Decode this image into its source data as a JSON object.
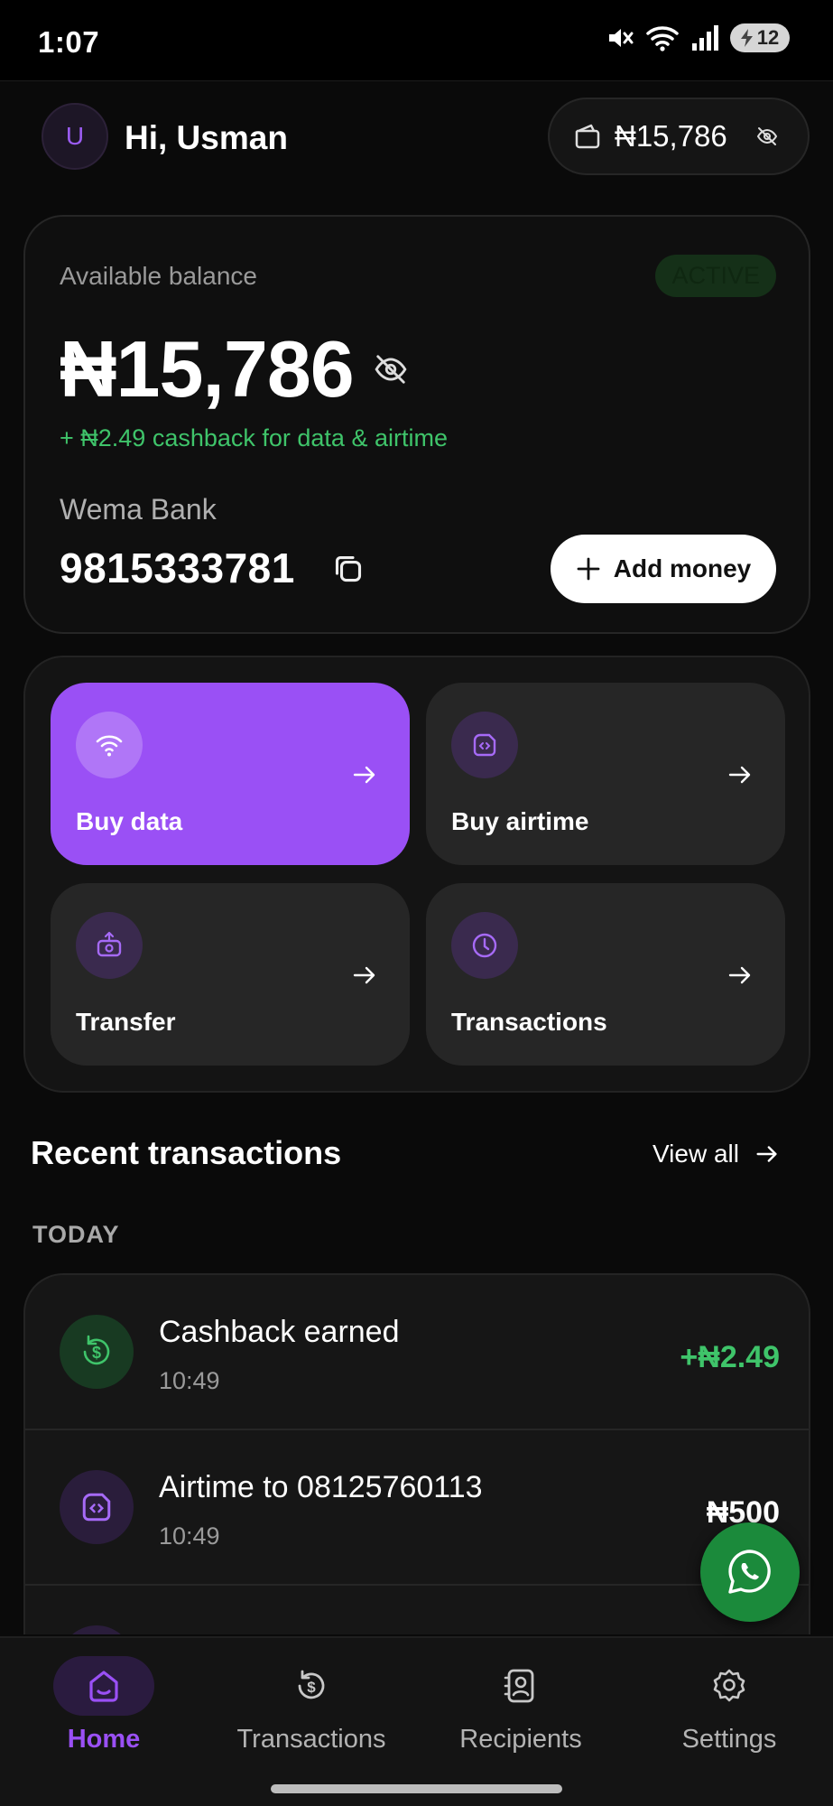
{
  "status_bar": {
    "time": "1:07",
    "battery": "12"
  },
  "header": {
    "avatar_initial": "U",
    "greeting": "Hi, Usman",
    "wallet_amount": "₦15,786"
  },
  "balance_card": {
    "label": "Available balance",
    "status": "ACTIVE",
    "amount": "₦15,786",
    "cashback_note": "+ ₦2.49 cashback for data & airtime",
    "bank_name": "Wema Bank",
    "account_number": "9815333781",
    "add_money_label": "Add money"
  },
  "quick_actions": [
    {
      "label": "Buy data",
      "icon": "wifi-icon"
    },
    {
      "label": "Buy airtime",
      "icon": "sim-card-icon"
    },
    {
      "label": "Transfer",
      "icon": "transfer-icon"
    },
    {
      "label": "Transactions",
      "icon": "clock-icon"
    }
  ],
  "recent": {
    "title": "Recent transactions",
    "view_all": "View all",
    "group_label": "TODAY",
    "items": [
      {
        "title": "Cashback earned",
        "time": "10:49",
        "amount": "+₦2.49",
        "amount_color": "#3fc46a"
      },
      {
        "title": "Airtime to 08125760113",
        "time": "10:49",
        "amount": "₦500",
        "amount_color": "#ffffff"
      }
    ]
  },
  "bottom_nav": [
    {
      "label": "Home",
      "active": true
    },
    {
      "label": "Transactions",
      "active": false
    },
    {
      "label": "Recipients",
      "active": false
    },
    {
      "label": "Settings",
      "active": false
    }
  ],
  "colors": {
    "accent": "#9a50f5",
    "success": "#3fc46a",
    "whatsapp": "#1b8a3b"
  }
}
